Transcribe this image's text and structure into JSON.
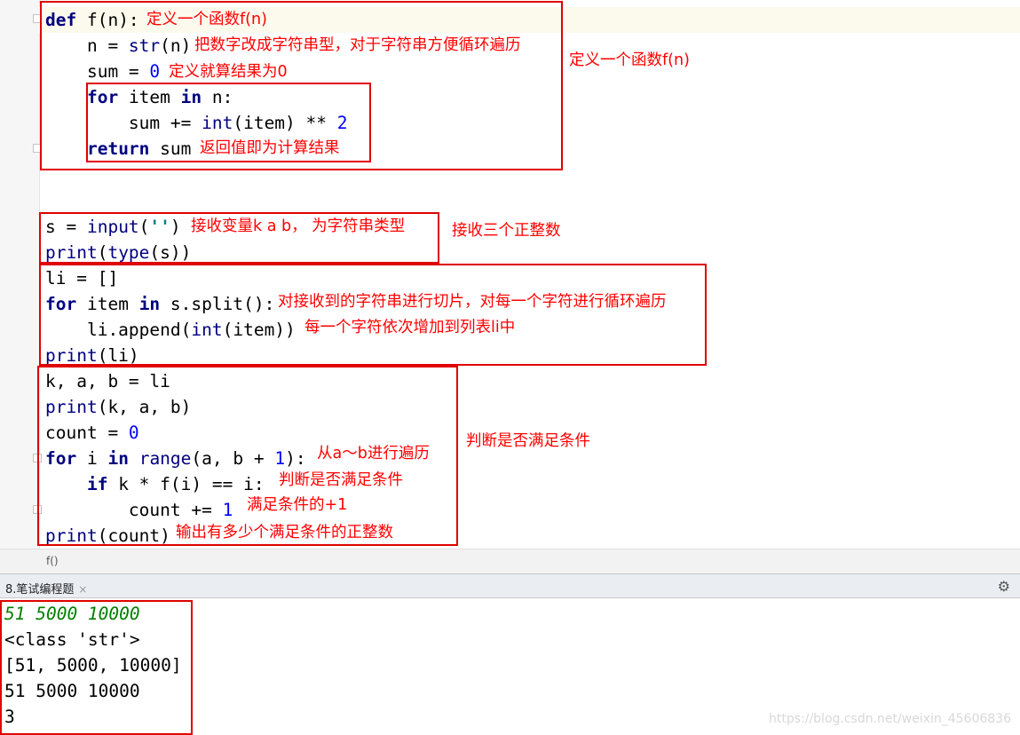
{
  "editor": {
    "code": {
      "l1_def": "def",
      "l1_sig": " f(n):",
      "l2_a": "    n = ",
      "l2_b": "str",
      "l2_c": "(n)",
      "l3_a": "    sum = ",
      "l3_b": "0",
      "l4_a": "    ",
      "l4_for": "for",
      "l4_b": " item ",
      "l4_in": "in",
      "l4_c": " n:",
      "l5_a": "        sum += ",
      "l5_int": "int",
      "l5_b": "(item) ** ",
      "l5_two": "2",
      "l6_a": "    ",
      "l6_ret": "return",
      "l6_b": " sum",
      "l7_a": "s = ",
      "l7_input": "input",
      "l7_b": "(",
      "l7_str": "''",
      "l7_c": ")",
      "l8_print": "print",
      "l8_a": "(",
      "l8_type": "type",
      "l8_b": "(s))",
      "l9": "li = []",
      "l10_for": "for",
      "l10_a": " item ",
      "l10_in": "in",
      "l10_b": " s.split():",
      "l11_a": "    li.append(",
      "l11_int": "int",
      "l11_b": "(item))",
      "l12_print": "print",
      "l12_a": "(li)",
      "l13": "k, a, b = li",
      "l14_print": "print",
      "l14_a": "(k, a, b)",
      "l15_a": "count = ",
      "l15_zero": "0",
      "l16_for": "for",
      "l16_a": " i ",
      "l16_in": "in",
      "l16_b": " ",
      "l16_range": "range",
      "l16_c": "(a, b + ",
      "l16_one": "1",
      "l16_d": "):",
      "l17_a": "    ",
      "l17_if": "if",
      "l17_b": " k * f(i) == i:",
      "l18_a": "        count += ",
      "l18_one": "1",
      "l19_print": "print",
      "l19_a": "(count)"
    },
    "annotations": {
      "a1": "定义一个函数f(n)",
      "a2": "把数字改成字符串型，对于字符串方便循环遍历",
      "a3": "定义就算结果为0",
      "a4": "返回值即为计算结果",
      "a5": "定义一个函数f(n)",
      "a6": "接收变量k a b， 为字符串类型",
      "a7": "接收三个正整数",
      "a8": "对接收到的字符串进行切片，对每一个字符进行循环遍历",
      "a9": "每一个字符依次增加到列表li中",
      "a10": "从a～b进行遍历",
      "a11": "判断是否满足条件",
      "a12": "满足条件的+1",
      "a13": "输出有多少个满足条件的正整数",
      "a14": "判断是否满足条件"
    }
  },
  "breadcrumb": {
    "text": "f()"
  },
  "run_panel": {
    "tab_label": "8.笔试编程题",
    "close_glyph": "×",
    "settings_glyph": "⚙"
  },
  "console": {
    "input_line": "51 5000 10000",
    "out1": "<class 'str'>",
    "out2": "[51, 5000, 10000]",
    "out3": "51 5000 10000",
    "out4": "3"
  },
  "watermark": "https://blog.csdn.net/weixin_45606836",
  "colors": {
    "annotation_red": "#ff0000",
    "keyword_navy": "#000080",
    "number_blue": "#0000ff",
    "input_green": "#008000"
  }
}
